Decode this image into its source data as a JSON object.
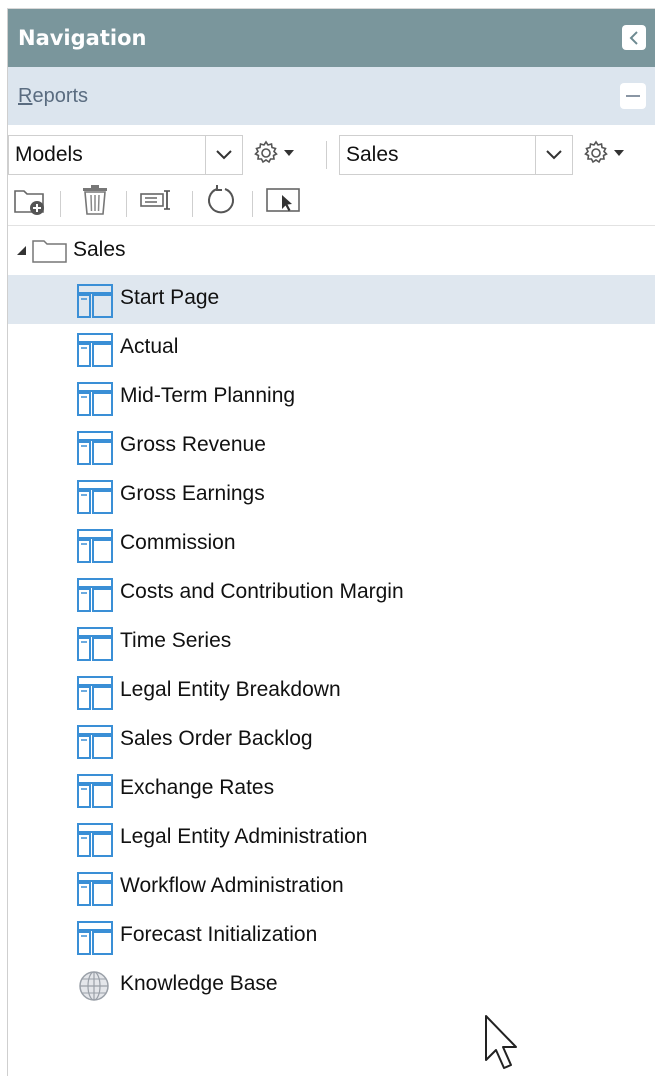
{
  "header": {
    "title": "Navigation"
  },
  "reports": {
    "label_first": "R",
    "label_rest": "eports"
  },
  "selectors": {
    "left": {
      "value": "Models"
    },
    "right": {
      "value": "Sales"
    }
  },
  "tree": {
    "root": {
      "label": "Sales"
    },
    "items": [
      {
        "label": "Start Page",
        "icon": "report-layout-icon",
        "selected": true
      },
      {
        "label": "Actual",
        "icon": "report-layout-icon"
      },
      {
        "label": "Mid-Term Planning",
        "icon": "report-layout-icon"
      },
      {
        "label": "Gross Revenue",
        "icon": "report-layout-icon"
      },
      {
        "label": "Gross Earnings",
        "icon": "report-layout-icon"
      },
      {
        "label": "Commission",
        "icon": "report-layout-icon"
      },
      {
        "label": "Costs and Contribution Margin",
        "icon": "report-layout-icon"
      },
      {
        "label": "Time Series",
        "icon": "report-layout-icon"
      },
      {
        "label": "Legal Entity Breakdown",
        "icon": "report-layout-icon"
      },
      {
        "label": "Sales Order Backlog",
        "icon": "report-layout-icon"
      },
      {
        "label": "Exchange Rates",
        "icon": "report-layout-icon"
      },
      {
        "label": "Legal Entity Administration",
        "icon": "report-layout-icon"
      },
      {
        "label": "Workflow Administration",
        "icon": "report-layout-icon"
      },
      {
        "label": "Forecast Initialization",
        "icon": "report-layout-icon"
      },
      {
        "label": "Knowledge Base",
        "icon": "globe-icon"
      }
    ]
  },
  "colors": {
    "header_bg": "#7a969c",
    "reports_bg": "#dce5ee",
    "selected_row_bg": "#dfe7ef",
    "icon_blue": "#3a8fd6"
  }
}
